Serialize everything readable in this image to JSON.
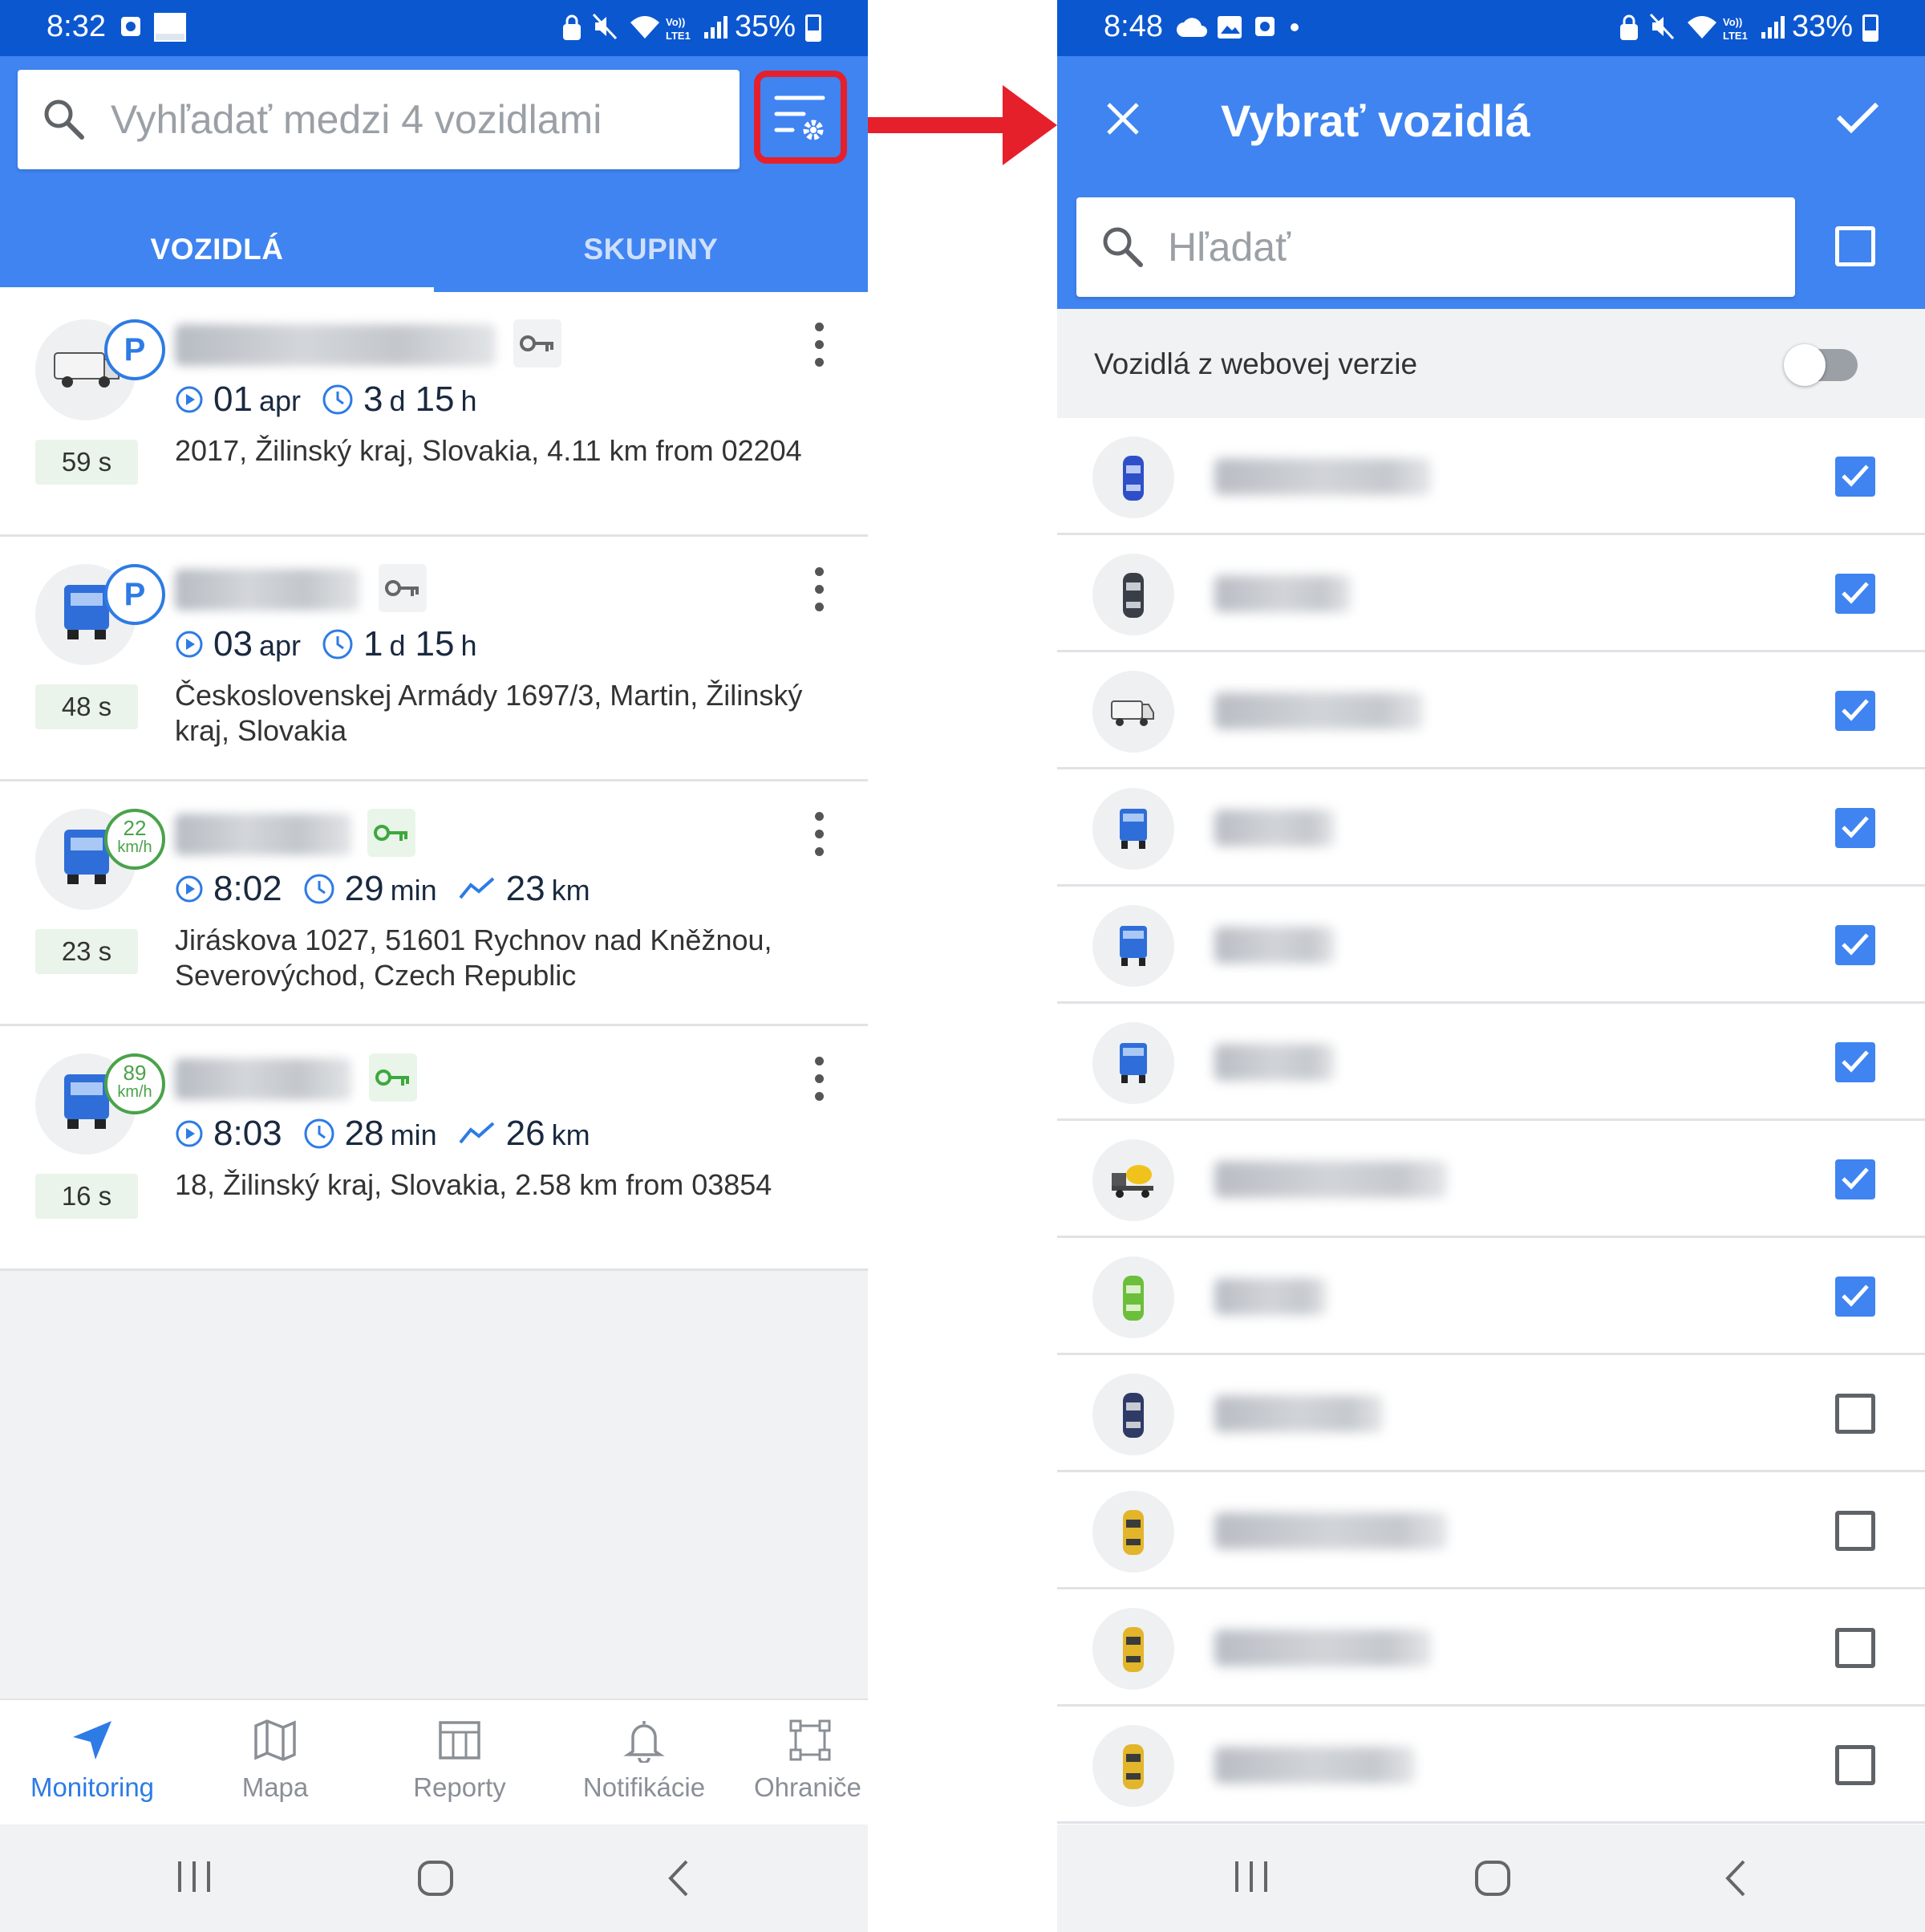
{
  "left": {
    "status": {
      "time": "8:32",
      "battery": "35%"
    },
    "search": {
      "placeholder": "Vyhľadať medzi 4 vozidlami"
    },
    "tabs": [
      {
        "label": "VOZIDLÁ",
        "active": true
      },
      {
        "label": "SKUPINY",
        "active": false
      }
    ],
    "vehicles": [
      {
        "icon": "van-icon",
        "status_badge": "P",
        "key_state": "off",
        "age": "59 s",
        "stats": [
          {
            "icon": "play-circle-icon",
            "value": "01",
            "unit": "apr"
          },
          {
            "icon": "clock-icon",
            "value": "3",
            "unit": "d"
          },
          {
            "icon": "",
            "value": "15",
            "unit": "h"
          }
        ],
        "address": "2017, Žilinský kraj, Slovakia, 4.11 km from 02204"
      },
      {
        "icon": "truck-icon",
        "status_badge": "P",
        "key_state": "off",
        "age": "48 s",
        "stats": [
          {
            "icon": "play-circle-icon",
            "value": "03",
            "unit": "apr"
          },
          {
            "icon": "clock-icon",
            "value": "1",
            "unit": "d"
          },
          {
            "icon": "",
            "value": "15",
            "unit": "h"
          }
        ],
        "address": "Československej Armády 1697/3, Martin, Žilinský kraj, Slovakia"
      },
      {
        "icon": "truck-icon",
        "speed": "22",
        "speed_unit": "km/h",
        "key_state": "on",
        "age": "23 s",
        "stats": [
          {
            "icon": "play-circle-icon",
            "value": "8:02",
            "unit": ""
          },
          {
            "icon": "clock-icon",
            "value": "29",
            "unit": "min"
          },
          {
            "icon": "route-icon",
            "value": "23",
            "unit": "km"
          }
        ],
        "address": "Jiráskova 1027, 51601 Rychnov nad Kněžnou, Severovýchod, Czech Republic"
      },
      {
        "icon": "truck-icon",
        "speed": "89",
        "speed_unit": "km/h",
        "key_state": "on",
        "age": "16 s",
        "stats": [
          {
            "icon": "play-circle-icon",
            "value": "8:03",
            "unit": ""
          },
          {
            "icon": "clock-icon",
            "value": "28",
            "unit": "min"
          },
          {
            "icon": "route-icon",
            "value": "26",
            "unit": "km"
          }
        ],
        "address": "18, Žilinský kraj, Slovakia, 2.58 km from 03854"
      }
    ],
    "nav": [
      {
        "label": "Monitoring",
        "icon": "navigation-arrow-icon",
        "active": true
      },
      {
        "label": "Mapa",
        "icon": "map-icon",
        "active": false
      },
      {
        "label": "Reporty",
        "icon": "report-table-icon",
        "active": false
      },
      {
        "label": "Notifikácie",
        "icon": "bell-icon",
        "active": false
      },
      {
        "label": "Ohraniče",
        "icon": "geofence-icon",
        "active": false
      }
    ]
  },
  "right": {
    "status": {
      "time": "8:48",
      "battery": "33%"
    },
    "title": "Vybrať vozidlá",
    "search": {
      "placeholder": "Hľadať"
    },
    "web_toggle": {
      "label": "Vozidlá z webovej verzie",
      "on": false
    },
    "vehicles": [
      {
        "icon": "car-blue-icon",
        "checked": true
      },
      {
        "icon": "car-dark-icon",
        "checked": true
      },
      {
        "icon": "van-icon",
        "checked": true
      },
      {
        "icon": "truck-icon",
        "checked": true
      },
      {
        "icon": "truck-icon",
        "checked": true
      },
      {
        "icon": "truck-icon",
        "checked": true
      },
      {
        "icon": "mixer-truck-icon",
        "checked": true
      },
      {
        "icon": "car-green-icon",
        "checked": true
      },
      {
        "icon": "car-dark-icon",
        "checked": false
      },
      {
        "icon": "car-yellow-icon",
        "checked": false
      },
      {
        "icon": "car-yellow-icon",
        "checked": false
      },
      {
        "icon": "car-yellow-icon",
        "checked": false
      }
    ]
  },
  "colors": {
    "status_bar": "#0b57d0",
    "header": "#3f84f1",
    "highlight": "#e5202b",
    "accent": "#2d7be5",
    "speed_green": "#4aa24a"
  }
}
